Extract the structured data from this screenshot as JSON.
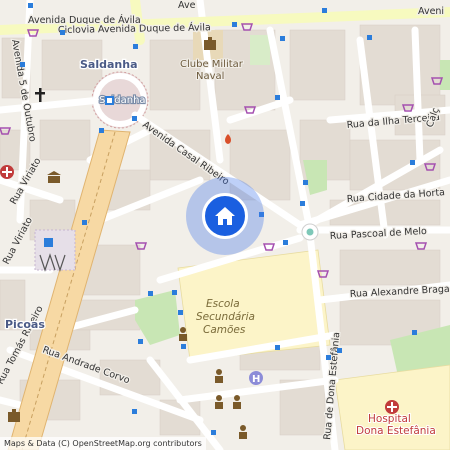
{
  "map": {
    "streets": {
      "avenida_duque_de_avila": "Avenida Duque de Ávila",
      "ciclovia_avenida_duque_de_avila": "Ciclovia Avenida Duque de Ávila",
      "avenida_5_de_outubro": "Avenida 5 de Outubro",
      "avenida_casal_ribeiro": "Avenida Casal Ribeiro",
      "rua_da_ilha_terceira": "Rua da Ilha Terceira",
      "rua_cidade_da_horta": "Rua Cidade da Horta",
      "rua_pascoal_de_melo": "Rua Pascoal de Melo",
      "rua_alexandre_braga": "Rua Alexandre Braga",
      "rua_andrade_corvo": "Rua Andrade Corvo",
      "rua_viriato": "Rua Viriato",
      "rua_viriato_2": "Rua Viriato",
      "rua_de_dona_estefania": "Rua de Dona Estefânia",
      "rua_tomas_ribeiro": "Rua Tomás Ribeiro",
      "rua_calcada": "Calç",
      "rua_fragment_nw": "Ave",
      "rua_fragment_ne": "Aveni"
    },
    "places": {
      "saldanha": "Saldanha",
      "saldanha_square": "Saldanha",
      "picoas": "Picoas"
    },
    "pois": {
      "clube_militar_naval": "Clube Militar\nNaval",
      "escola_secundaria_camoes": "Escola\nSecundária\nCamões",
      "hospital_dona_estefania": "Hospital\nDona Estefânia"
    },
    "icons": {
      "location": "home-icon",
      "metro": "metro-icon",
      "bus": "bus-stop-icon",
      "shop": "shop-icon",
      "church": "church-icon",
      "fire": "fire-station-icon",
      "museum": "museum-icon",
      "hospital": "hospital-icon",
      "parking": "parking-icon"
    },
    "colors": {
      "background": "#f2efe9",
      "road_major": "#f7fabf",
      "road_minor": "#ffffff",
      "water_blue": "#2b7ddb",
      "park": "#c8e6b4",
      "school_area": "#fcf4c8",
      "hospital_area": "#fcf4c8",
      "shop": "#a550b0",
      "location_marker": "#1a5fe0"
    }
  },
  "attribution": "Maps & Data (C) OpenStreetMap.org contributors"
}
